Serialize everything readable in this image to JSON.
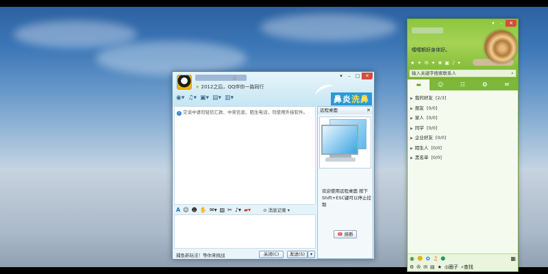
{
  "chat": {
    "status_text": "2012之后，QQ伴你一路同行",
    "status_badge": "VIP",
    "toolbar_icons": [
      "camera-icon",
      "mic-icon",
      "share-icon",
      "file-icon",
      "app-icon"
    ],
    "banner_text_1": "鼻炎",
    "banner_text_2": "洗鼻",
    "notice": "交谈中请勿轻信汇款、中奖信息、陌生电话，勿使用外挂软件。",
    "history_label": "消息记录",
    "footer_ad": "捕鱼新玩法！等你来挑战",
    "close_label": "关闭(C)",
    "send_label": "发送(S)",
    "side_title": "远程桌面",
    "side_desc": "欢迎使用远程桌面 按下Shift+ESC键可以停止控制",
    "hangup_label": "挂断"
  },
  "buddy": {
    "signature": "嘤嘤额好身体好。",
    "search_placeholder": "输入关键字搜索联系人",
    "tabs": [
      "contacts",
      "groups",
      "discussion",
      "space",
      "email"
    ],
    "groups": [
      {
        "name": "我的好友",
        "count": "[2/3]"
      },
      {
        "name": "朋友",
        "count": "[0/0]"
      },
      {
        "name": "家人",
        "count": "[0/0]"
      },
      {
        "name": "同学",
        "count": "[0/0]"
      },
      {
        "name": "企业好友",
        "count": "[0/0]"
      },
      {
        "name": "陌生人",
        "count": "[0/0]"
      },
      {
        "name": "黑名单",
        "count": "[0/0]"
      }
    ],
    "bottom_open": "圈子",
    "bottom_find": "查找"
  }
}
